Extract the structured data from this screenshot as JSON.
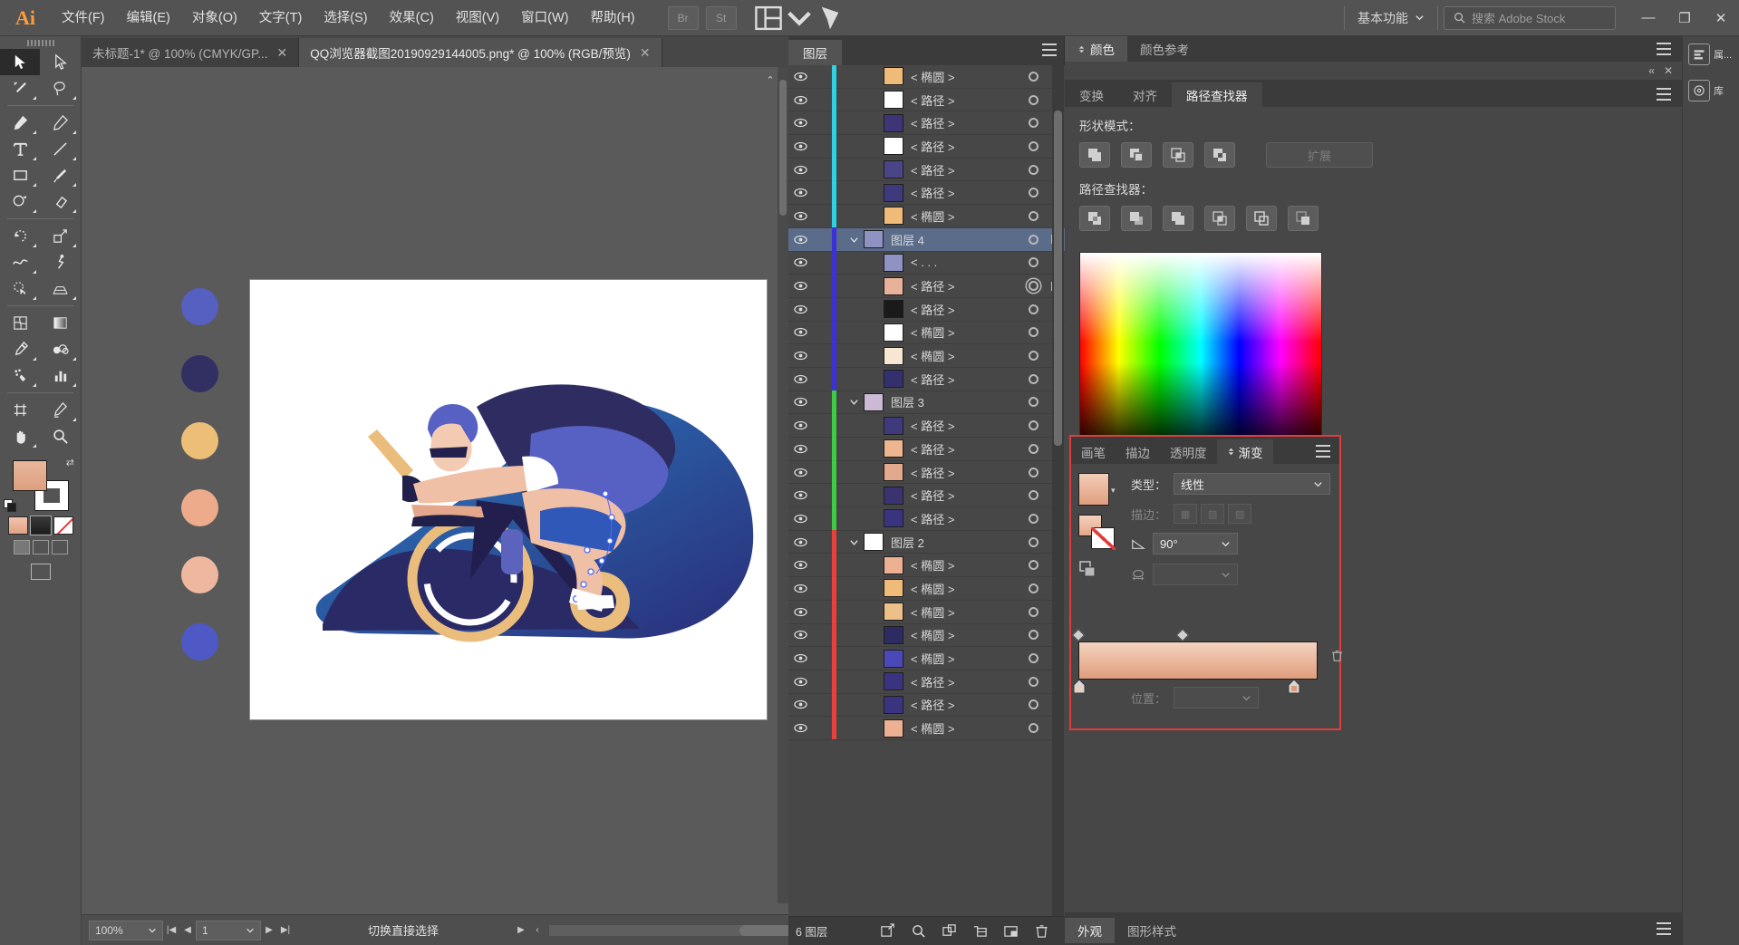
{
  "app": {
    "logo": "Ai",
    "menus": [
      "文件(F)",
      "编辑(E)",
      "对象(O)",
      "文字(T)",
      "选择(S)",
      "效果(C)",
      "视图(V)",
      "窗口(W)",
      "帮助(H)"
    ],
    "bridge_label": "Br",
    "stock_label": "St",
    "workspace": "基本功能",
    "search_placeholder": "搜索 Adobe Stock",
    "win_minimize": "—",
    "win_restore": "❐",
    "win_close": "✕"
  },
  "tabs": [
    {
      "title": "未标题-1* @ 100% (CMYK/GP...",
      "active": false,
      "close": "✕"
    },
    {
      "title": "QQ浏览器截图20190929144005.png* @ 100% (RGB/预览)",
      "active": true,
      "close": "✕"
    }
  ],
  "tools": [
    {
      "name": "selection-tool",
      "selected": true
    },
    {
      "name": "direct-selection-tool",
      "selected": false
    },
    {
      "name": "magic-wand-tool",
      "selected": false
    },
    {
      "name": "lasso-tool",
      "selected": false
    },
    {
      "name": "pen-tool",
      "selected": false
    },
    {
      "name": "curvature-tool",
      "selected": false
    },
    {
      "name": "type-tool",
      "selected": false
    },
    {
      "name": "line-segment-tool",
      "selected": false
    },
    {
      "name": "rectangle-tool",
      "selected": false
    },
    {
      "name": "paintbrush-tool",
      "selected": false
    },
    {
      "name": "shaper-tool",
      "selected": false
    },
    {
      "name": "eraser-tool",
      "selected": false
    },
    {
      "name": "rotate-tool",
      "selected": false
    },
    {
      "name": "scale-tool",
      "selected": false
    },
    {
      "name": "width-tool",
      "selected": false
    },
    {
      "name": "free-transform-tool",
      "selected": false
    },
    {
      "name": "shape-builder-tool",
      "selected": false
    },
    {
      "name": "perspective-grid-tool",
      "selected": false
    },
    {
      "name": "mesh-tool",
      "selected": false
    },
    {
      "name": "gradient-tool",
      "selected": false
    },
    {
      "name": "eyedropper-tool",
      "selected": false
    },
    {
      "name": "blend-tool",
      "selected": false
    },
    {
      "name": "symbol-sprayer-tool",
      "selected": false
    },
    {
      "name": "column-graph-tool",
      "selected": false
    },
    {
      "name": "artboard-tool",
      "selected": false
    },
    {
      "name": "slice-tool",
      "selected": false
    },
    {
      "name": "hand-tool",
      "selected": false
    },
    {
      "name": "zoom-tool",
      "selected": false
    }
  ],
  "canvas": {
    "swatches": [
      "#5560c0",
      "#322f63",
      "#edbe77",
      "#eeab8c",
      "#efb79e",
      "#4f59c5"
    ],
    "artboard_bg": "#ffffff"
  },
  "status": {
    "zoom": "100%",
    "page": "1",
    "message": "切换直接选择"
  },
  "layers_panel": {
    "tab": "图层",
    "footer_count": "6 图层",
    "rows": [
      {
        "name": "< 椭圆 >",
        "color": "#2fd2e3",
        "indent": 36,
        "type": "item",
        "thumb": "#f0bb78",
        "selected": false,
        "target_selected": false,
        "expanded": false
      },
      {
        "name": "< 路径 >",
        "color": "#2fd2e3",
        "indent": 36,
        "type": "item",
        "thumb": "#ffffff",
        "selected": false,
        "target_selected": false,
        "expanded": false
      },
      {
        "name": "< 路径 >",
        "color": "#2fd2e3",
        "indent": 36,
        "type": "item",
        "thumb": "#3c3676",
        "selected": false,
        "target_selected": false,
        "expanded": false
      },
      {
        "name": "< 路径 >",
        "color": "#2fd2e3",
        "indent": 36,
        "type": "item",
        "thumb": "#ffffff",
        "selected": false,
        "target_selected": false,
        "expanded": false
      },
      {
        "name": "< 路径 >",
        "color": "#2fd2e3",
        "indent": 36,
        "type": "item",
        "thumb": "#4a4488",
        "selected": false,
        "target_selected": false,
        "expanded": false
      },
      {
        "name": "< 路径 >",
        "color": "#2fd2e3",
        "indent": 36,
        "type": "item",
        "thumb": "#3f3a7d",
        "selected": false,
        "target_selected": false,
        "expanded": false
      },
      {
        "name": "< 椭圆 >",
        "color": "#2fd2e3",
        "indent": 36,
        "type": "item",
        "thumb": "#f0bb78",
        "selected": false,
        "target_selected": false,
        "expanded": false
      },
      {
        "name": "图层 4",
        "color": "#3b31d8",
        "indent": 14,
        "type": "group",
        "thumb": "#8e93c4",
        "selected": true,
        "target_selected": true,
        "expanded": true
      },
      {
        "name": "< . . .",
        "color": "#3b31d8",
        "indent": 36,
        "type": "item",
        "thumb": "#8e93c4",
        "selected": false,
        "target_selected": false,
        "expanded": false
      },
      {
        "name": "< 路径 >",
        "color": "#3b31d8",
        "indent": 36,
        "type": "item",
        "thumb": "#e8b29a",
        "selected": false,
        "target_selected": true,
        "expanded": false
      },
      {
        "name": "< 路径 >",
        "color": "#3b31d8",
        "indent": 36,
        "type": "item",
        "thumb": "#1a1a1a",
        "selected": false,
        "target_selected": false,
        "expanded": false
      },
      {
        "name": "< 椭圆 >",
        "color": "#3b31d8",
        "indent": 36,
        "type": "item",
        "thumb": "#ffffff",
        "selected": false,
        "target_selected": false,
        "expanded": false
      },
      {
        "name": "< 椭圆 >",
        "color": "#3b31d8",
        "indent": 36,
        "type": "item",
        "thumb": "#f7e7d2",
        "selected": false,
        "target_selected": false,
        "expanded": false
      },
      {
        "name": "< 路径 >",
        "color": "#3b31d8",
        "indent": 36,
        "type": "item",
        "thumb": "#34306e",
        "selected": false,
        "target_selected": false,
        "expanded": false
      },
      {
        "name": "图层 3",
        "color": "#3ecb45",
        "indent": 14,
        "type": "group",
        "thumb": "#cbb9d6",
        "selected": false,
        "target_selected": false,
        "expanded": true
      },
      {
        "name": "< 路径 >",
        "color": "#3ecb45",
        "indent": 36,
        "type": "item",
        "thumb": "#3f3a7d",
        "selected": false,
        "target_selected": false,
        "expanded": false
      },
      {
        "name": "< 路径 >",
        "color": "#3ecb45",
        "indent": 36,
        "type": "item",
        "thumb": "#eeb68f",
        "selected": false,
        "target_selected": false,
        "expanded": false
      },
      {
        "name": "< 路径 >",
        "color": "#3ecb45",
        "indent": 36,
        "type": "item",
        "thumb": "#e2a98d",
        "selected": false,
        "target_selected": false,
        "expanded": false
      },
      {
        "name": "< 路径 >",
        "color": "#3ecb45",
        "indent": 36,
        "type": "item",
        "thumb": "#39336f",
        "selected": false,
        "target_selected": false,
        "expanded": false
      },
      {
        "name": "< 路径 >",
        "color": "#3ecb45",
        "indent": 36,
        "type": "item",
        "thumb": "#3a3480",
        "selected": false,
        "target_selected": false,
        "expanded": false
      },
      {
        "name": "图层 2",
        "color": "#e8403a",
        "indent": 14,
        "type": "group",
        "thumb": "#ffffff",
        "selected": false,
        "target_selected": false,
        "expanded": true
      },
      {
        "name": "< 椭圆 >",
        "color": "#e8403a",
        "indent": 36,
        "type": "item",
        "thumb": "#eeb093",
        "selected": false,
        "target_selected": false,
        "expanded": false
      },
      {
        "name": "< 椭圆 >",
        "color": "#e8403a",
        "indent": 36,
        "type": "item",
        "thumb": "#f0bb78",
        "selected": false,
        "target_selected": false,
        "expanded": false
      },
      {
        "name": "< 椭圆 >",
        "color": "#e8403a",
        "indent": 36,
        "type": "item",
        "thumb": "#edc089",
        "selected": false,
        "target_selected": false,
        "expanded": false
      },
      {
        "name": "< 椭圆 >",
        "color": "#e8403a",
        "indent": 36,
        "type": "item",
        "thumb": "#2e2b63",
        "selected": false,
        "target_selected": false,
        "expanded": false
      },
      {
        "name": "< 椭圆 >",
        "color": "#e8403a",
        "indent": 36,
        "type": "item",
        "thumb": "#4b49ba",
        "selected": false,
        "target_selected": false,
        "expanded": false
      },
      {
        "name": "< 路径 >",
        "color": "#e8403a",
        "indent": 36,
        "type": "item",
        "thumb": "#3a3480",
        "selected": false,
        "target_selected": false,
        "expanded": false
      },
      {
        "name": "< 路径 >",
        "color": "#e8403a",
        "indent": 36,
        "type": "item",
        "thumb": "#3a3480",
        "selected": false,
        "target_selected": false,
        "expanded": false
      },
      {
        "name": "< 椭圆 >",
        "color": "#e8403a",
        "indent": 36,
        "type": "item",
        "thumb": "#eeb093",
        "selected": false,
        "target_selected": false,
        "expanded": false
      }
    ],
    "footer_icons": [
      "make-clipping-mask-icon",
      "locate-object-icon",
      "make-sublayer-icon",
      "create-new-sublayer-icon",
      "create-new-layer-icon",
      "delete-selection-icon"
    ]
  },
  "color_panel": {
    "tabs": [
      {
        "label": "颜色",
        "active": true
      },
      {
        "label": "颜色参考",
        "active": false
      }
    ]
  },
  "pathfinder_panel": {
    "collapse": "«",
    "close": "✕",
    "tabs": [
      {
        "label": "变换",
        "active": false
      },
      {
        "label": "对齐",
        "active": false
      },
      {
        "label": "路径查找器",
        "active": true
      }
    ],
    "shape_modes_label": "形状模式：",
    "pathfinder_label": "路径查找器：",
    "expand_label": "扩展",
    "shape_modes": [
      "unite-icon",
      "minus-front-icon",
      "intersect-icon",
      "exclude-icon"
    ],
    "pathfinders": [
      "divide-icon",
      "trim-icon",
      "merge-icon",
      "crop-icon",
      "outline-icon",
      "minus-back-icon"
    ]
  },
  "gradient_panel": {
    "tabs": [
      {
        "label": "画笔",
        "active": false
      },
      {
        "label": "描边",
        "active": false
      },
      {
        "label": "透明度",
        "active": false
      },
      {
        "label": "渐变",
        "active": true
      }
    ],
    "type_label": "类型：",
    "type_value": "线性",
    "stroke_label": "描边：",
    "angle_value": "90°",
    "opacity_label": "不透明度：",
    "opacity_value": "",
    "location_label": "位置：",
    "location_value": "",
    "ramp_start": "#f5d3c0",
    "ramp_end": "#df9d7c",
    "highlight_color": "#e33b3b"
  },
  "appearance_panel": {
    "tabs": [
      {
        "label": "外观",
        "active": true
      },
      {
        "label": "图形样式",
        "active": false
      }
    ]
  },
  "mini_dock": [
    {
      "label": "属...",
      "icon": "properties-icon"
    },
    {
      "label": "库",
      "icon": "libraries-icon"
    }
  ]
}
